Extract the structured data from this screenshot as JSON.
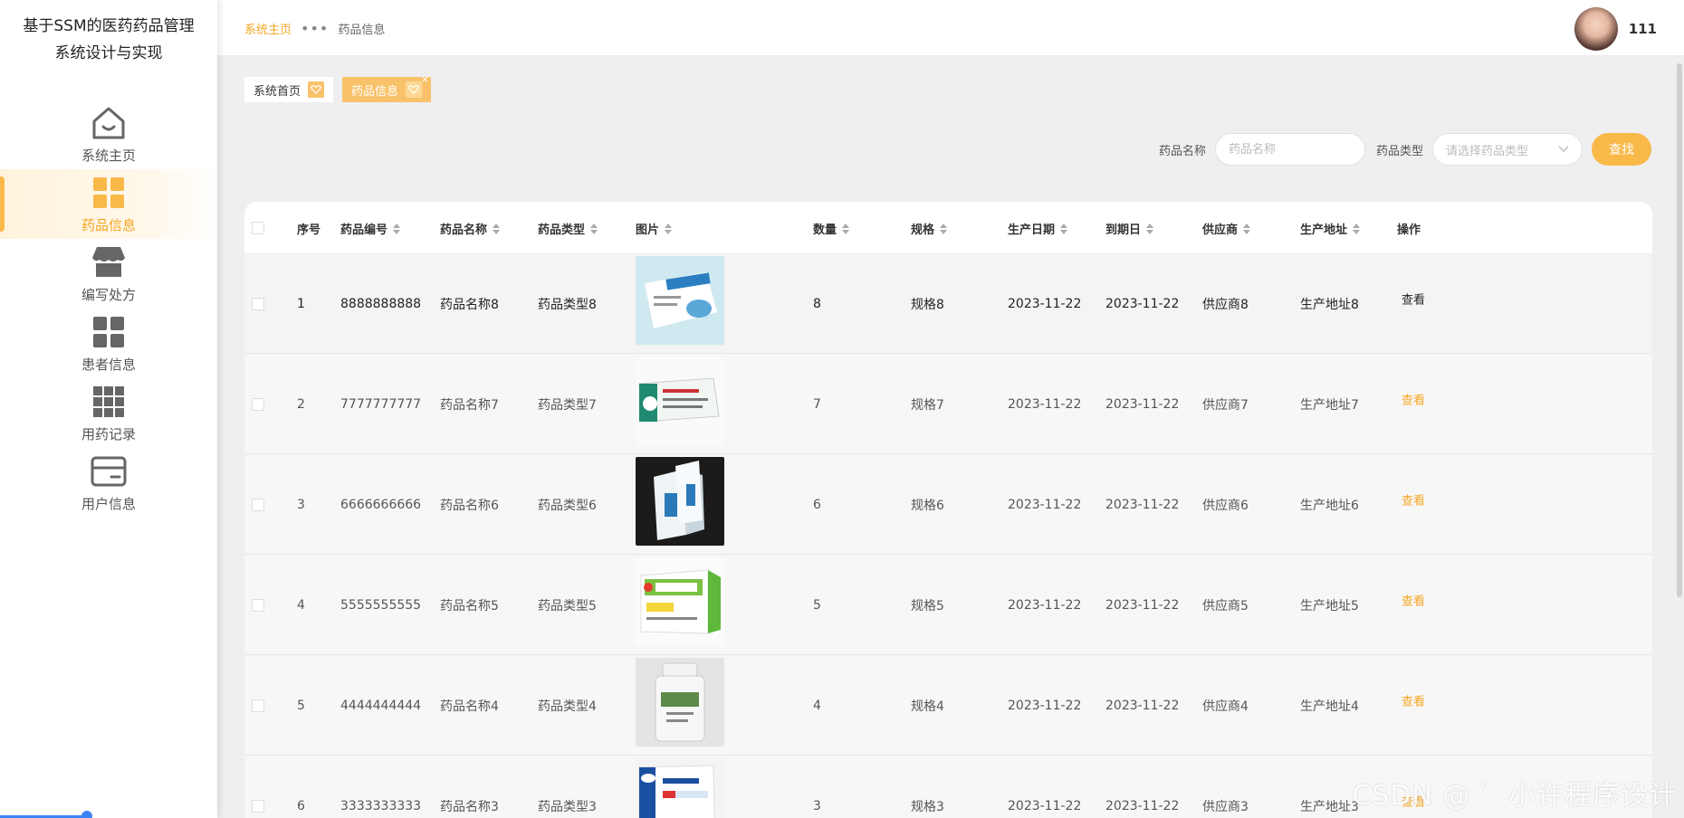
{
  "app": {
    "title_line1": "基于SSM的医药药品管理",
    "title_line2": "系统设计与实现"
  },
  "sidebar": {
    "items": [
      {
        "label": "系统主页",
        "icon": "home-icon",
        "active": false
      },
      {
        "label": "药品信息",
        "icon": "grid-icon",
        "active": true
      },
      {
        "label": "编写处方",
        "icon": "store-icon",
        "active": false
      },
      {
        "label": "患者信息",
        "icon": "grid-icon",
        "active": false
      },
      {
        "label": "用药记录",
        "icon": "grid-nine-icon",
        "active": false
      },
      {
        "label": "用户信息",
        "icon": "card-icon",
        "active": false
      }
    ]
  },
  "header": {
    "breadcrumb_home": "系统主页",
    "breadcrumb_sep": "•••",
    "breadcrumb_current": "药品信息",
    "username": "111"
  },
  "tabs": [
    {
      "label": "系统首页",
      "closable": false
    },
    {
      "label": "药品信息",
      "closable": true
    }
  ],
  "search": {
    "name_label": "药品名称",
    "name_placeholder": "药品名称",
    "type_label": "药品类型",
    "type_placeholder": "请选择药品类型",
    "button": "查找"
  },
  "table": {
    "columns": [
      "序号",
      "药品编号",
      "药品名称",
      "药品类型",
      "图片",
      "数量",
      "规格",
      "生产日期",
      "到期日",
      "供应商",
      "生产地址",
      "操作"
    ],
    "rows": [
      {
        "index": "1",
        "code": "8888888888",
        "name": "药品名称8",
        "type": "药品类型8",
        "qty": "8",
        "spec": "规格8",
        "mfg": "2023-11-22",
        "exp": "2023-11-22",
        "supplier": "供应商8",
        "address": "生产地址8",
        "action": "查看"
      },
      {
        "index": "2",
        "code": "7777777777",
        "name": "药品名称7",
        "type": "药品类型7",
        "qty": "7",
        "spec": "规格7",
        "mfg": "2023-11-22",
        "exp": "2023-11-22",
        "supplier": "供应商7",
        "address": "生产地址7",
        "action": "查看"
      },
      {
        "index": "3",
        "code": "6666666666",
        "name": "药品名称6",
        "type": "药品类型6",
        "qty": "6",
        "spec": "规格6",
        "mfg": "2023-11-22",
        "exp": "2023-11-22",
        "supplier": "供应商6",
        "address": "生产地址6",
        "action": "查看"
      },
      {
        "index": "4",
        "code": "5555555555",
        "name": "药品名称5",
        "type": "药品类型5",
        "qty": "5",
        "spec": "规格5",
        "mfg": "2023-11-22",
        "exp": "2023-11-22",
        "supplier": "供应商5",
        "address": "生产地址5",
        "action": "查看"
      },
      {
        "index": "5",
        "code": "4444444444",
        "name": "药品名称4",
        "type": "药品类型4",
        "qty": "4",
        "spec": "规格4",
        "mfg": "2023-11-22",
        "exp": "2023-11-22",
        "supplier": "供应商4",
        "address": "生产地址4",
        "action": "查看"
      },
      {
        "index": "6",
        "code": "3333333333",
        "name": "药品名称3",
        "type": "药品类型3",
        "qty": "3",
        "spec": "规格3",
        "mfg": "2023-11-22",
        "exp": "2023-11-22",
        "supplier": "供应商3",
        "address": "生产地址3",
        "action": "查看"
      }
    ]
  },
  "watermark": "CSDN @ ゛小许程序设计",
  "colors": {
    "accent": "#f9b949",
    "accent_text": "#f5a623",
    "background": "#efeff1"
  }
}
